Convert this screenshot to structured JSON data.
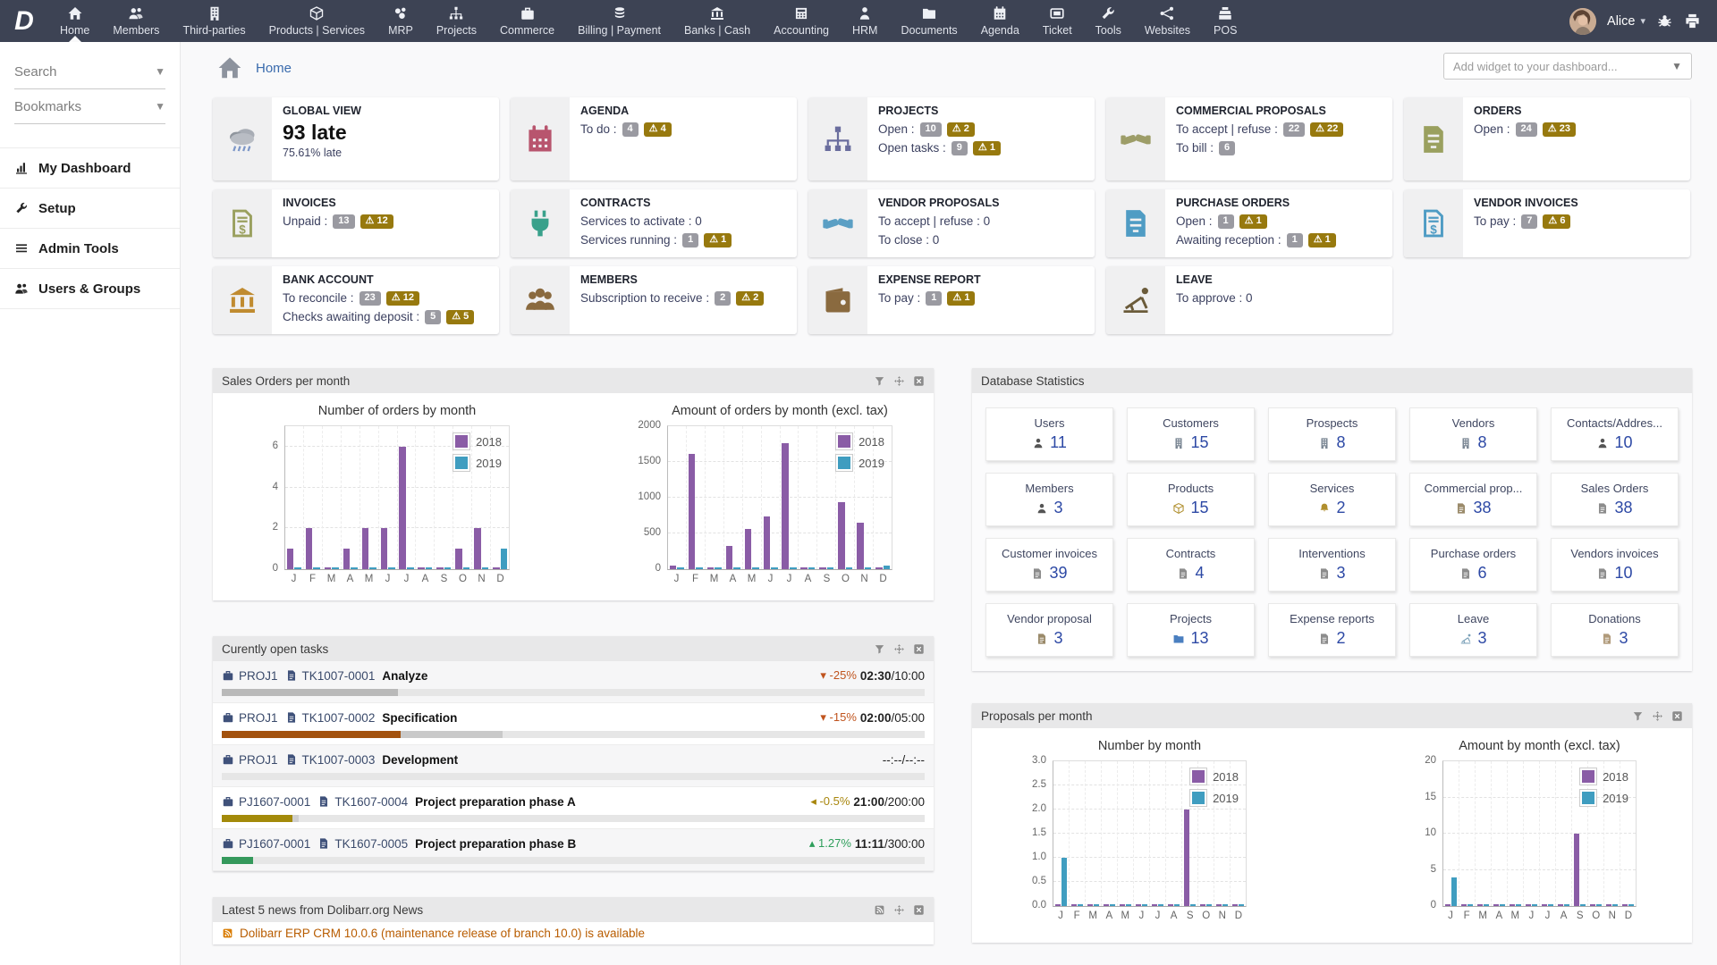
{
  "nav": {
    "logo": "D",
    "items": [
      {
        "label": "Home",
        "icon": "home"
      },
      {
        "label": "Members",
        "icon": "users"
      },
      {
        "label": "Third-parties",
        "icon": "building"
      },
      {
        "label": "Products | Services",
        "icon": "cube"
      },
      {
        "label": "MRP",
        "icon": "mrp"
      },
      {
        "label": "Projects",
        "icon": "sitemap"
      },
      {
        "label": "Commerce",
        "icon": "briefcase"
      },
      {
        "label": "Billing | Payment",
        "icon": "coins"
      },
      {
        "label": "Banks | Cash",
        "icon": "bank"
      },
      {
        "label": "Accounting",
        "icon": "calc"
      },
      {
        "label": "HRM",
        "icon": "person-tie"
      },
      {
        "label": "Documents",
        "icon": "folder"
      },
      {
        "label": "Agenda",
        "icon": "calendar"
      },
      {
        "label": "Ticket",
        "icon": "ticket"
      },
      {
        "label": "Tools",
        "icon": "wrench"
      },
      {
        "label": "Websites",
        "icon": "network"
      },
      {
        "label": "POS",
        "icon": "register"
      }
    ],
    "active_index": 0,
    "user_name": "Alice"
  },
  "sidebar": {
    "search_label": "Search",
    "bookmarks_label": "Bookmarks",
    "items": [
      {
        "label": "My Dashboard",
        "icon": "chart"
      },
      {
        "label": "Setup",
        "icon": "wrench"
      },
      {
        "label": "Admin Tools",
        "icon": "list"
      },
      {
        "label": "Users & Groups",
        "icon": "users"
      }
    ]
  },
  "header": {
    "breadcrumb": "Home",
    "add_widget_placeholder": "Add widget to your dashboard..."
  },
  "widgets": [
    {
      "title": "GLOBAL VIEW",
      "icon": "cloud-rain",
      "icon_color": "#9aa0a8",
      "tall": true,
      "big": "93 late",
      "sub": "75.61% late",
      "lines": []
    },
    {
      "title": "AGENDA",
      "icon": "calendar",
      "icon_color": "#b8556e",
      "tall": true,
      "lines": [
        {
          "text": "To do :",
          "count": "4",
          "warn": "4"
        }
      ]
    },
    {
      "title": "PROJECTS",
      "icon": "sitemap",
      "icon_color": "#6a6d9e",
      "tall": true,
      "lines": [
        {
          "text": "Open :",
          "count": "10",
          "warn": "2"
        },
        {
          "text": "Open tasks :",
          "count": "9",
          "warn": "1"
        }
      ]
    },
    {
      "title": "COMMERCIAL PROPOSALS",
      "icon": "handshake",
      "icon_color": "#9d9d68",
      "tall": true,
      "lines": [
        {
          "text": "To accept | refuse :",
          "count": "22",
          "warn": "22"
        },
        {
          "text": "To bill :",
          "count": "6"
        }
      ]
    },
    {
      "title": "ORDERS",
      "icon": "document",
      "icon_color": "#9aa05f",
      "tall": true,
      "lines": [
        {
          "text": "Open :",
          "count": "24",
          "warn": "23"
        }
      ]
    },
    {
      "title": "INVOICES",
      "icon": "bill",
      "icon_color": "#9aa05f",
      "lines": [
        {
          "text": "Unpaid :",
          "count": "13",
          "warn": "12"
        }
      ]
    },
    {
      "title": "CONTRACTS",
      "icon": "plug",
      "icon_color": "#39a18b",
      "lines": [
        {
          "text": "Services to activate : 0"
        },
        {
          "text": "Services running :",
          "count": "1",
          "warn": "1"
        }
      ]
    },
    {
      "title": "VENDOR PROPOSALS",
      "icon": "handshake",
      "icon_color": "#5b9fc4",
      "lines": [
        {
          "text": "To accept | refuse : 0"
        },
        {
          "text": "To close : 0"
        }
      ]
    },
    {
      "title": "PURCHASE ORDERS",
      "icon": "document",
      "icon_color": "#4f9cc4",
      "lines": [
        {
          "text": "Open :",
          "count": "1",
          "warn": "1"
        },
        {
          "text": "Awaiting reception :",
          "count": "1",
          "warn": "1"
        }
      ]
    },
    {
      "title": "VENDOR INVOICES",
      "icon": "bill",
      "icon_color": "#4f9cc4",
      "lines": [
        {
          "text": "To pay :",
          "count": "7",
          "warn": "6"
        }
      ]
    },
    {
      "title": "BANK ACCOUNT",
      "icon": "bank",
      "icon_color": "#c08b30",
      "lines": [
        {
          "text": "To reconcile :",
          "count": "23",
          "warn": "12"
        },
        {
          "text": "Checks awaiting deposit :",
          "count": "5",
          "warn": "5"
        }
      ]
    },
    {
      "title": "MEMBERS",
      "icon": "users-group",
      "icon_color": "#8a6a3f",
      "lines": [
        {
          "text": "Subscription to receive :",
          "count": "2",
          "warn": "2"
        }
      ]
    },
    {
      "title": "EXPENSE REPORT",
      "icon": "wallet",
      "icon_color": "#8a6a3f",
      "lines": [
        {
          "text": "To pay :",
          "count": "1",
          "warn": "1"
        }
      ]
    },
    {
      "title": "LEAVE",
      "icon": "beach",
      "icon_color": "#6b5b3a",
      "lines": [
        {
          "text": "To approve : 0"
        }
      ]
    }
  ],
  "panels": {
    "sales_orders": {
      "title": "Sales Orders per month",
      "icons": [
        "filter",
        "move",
        "close"
      ]
    },
    "db_stats": {
      "title": "Database Statistics",
      "cards": [
        {
          "label": "Users",
          "value": "11",
          "icon": "person",
          "icon_color": "#555555"
        },
        {
          "label": "Customers",
          "value": "15",
          "icon": "building",
          "icon_color": "#7b8794"
        },
        {
          "label": "Prospects",
          "value": "8",
          "icon": "building",
          "icon_color": "#7b8794"
        },
        {
          "label": "Vendors",
          "value": "8",
          "icon": "building",
          "icon_color": "#7b8794"
        },
        {
          "label": "Contacts/Addres...",
          "value": "10",
          "icon": "person",
          "icon_color": "#555555"
        },
        {
          "label": "Members",
          "value": "3",
          "icon": "person",
          "icon_color": "#555555"
        },
        {
          "label": "Products",
          "value": "15",
          "icon": "cube",
          "icon_color": "#b08f2e"
        },
        {
          "label": "Services",
          "value": "2",
          "icon": "bell",
          "icon_color": "#b08f2e"
        },
        {
          "label": "Commercial prop...",
          "value": "38",
          "icon": "page",
          "icon_color": "#9a8a6a"
        },
        {
          "label": "Sales Orders",
          "value": "38",
          "icon": "page",
          "icon_color": "#8c8c8c"
        },
        {
          "label": "Customer invoices",
          "value": "39",
          "icon": "page",
          "icon_color": "#8c8c8c"
        },
        {
          "label": "Contracts",
          "value": "4",
          "icon": "page",
          "icon_color": "#8c8c8c"
        },
        {
          "label": "Interventions",
          "value": "3",
          "icon": "page",
          "icon_color": "#8c8c8c"
        },
        {
          "label": "Purchase orders",
          "value": "6",
          "icon": "page",
          "icon_color": "#8c8c8c"
        },
        {
          "label": "Vendors invoices",
          "value": "10",
          "icon": "page",
          "icon_color": "#8c8c8c"
        },
        {
          "label": "Vendor proposal",
          "value": "3",
          "icon": "page",
          "icon_color": "#9a8a6a"
        },
        {
          "label": "Projects",
          "value": "13",
          "icon": "folder",
          "icon_color": "#4a7fc0"
        },
        {
          "label": "Expense reports",
          "value": "2",
          "icon": "page",
          "icon_color": "#8c8c8c"
        },
        {
          "label": "Leave",
          "value": "3",
          "icon": "beach",
          "icon_color": "#7aa0b8"
        },
        {
          "label": "Donations",
          "value": "3",
          "icon": "page",
          "icon_color": "#b09a7a"
        }
      ],
      "icons": []
    },
    "tasks": {
      "title": "Curently open tasks",
      "icons": [
        "filter",
        "move",
        "close"
      ],
      "rows": [
        {
          "project": "PROJ1",
          "task": "TK1007-0001",
          "name": "Analyze",
          "delta": "-25%",
          "delta_dir": "down",
          "delta_color": "#c0541e",
          "time_main": "02:30",
          "time_rest": "/10:00",
          "bars": [
            {
              "color": "#b9b9b9",
              "pct": 25
            }
          ]
        },
        {
          "project": "PROJ1",
          "task": "TK1007-0002",
          "name": "Specification",
          "delta": "-15%",
          "delta_dir": "down",
          "delta_color": "#c0541e",
          "time_main": "02:00",
          "time_rest": "/05:00",
          "bars": [
            {
              "color": "#a3520e",
              "pct": 25.5
            },
            {
              "color": "#c9c9c9",
              "pct": 14.5
            }
          ]
        },
        {
          "project": "PROJ1",
          "task": "TK1007-0003",
          "name": "Development",
          "delta": "",
          "delta_dir": "",
          "delta_color": "",
          "time_main": "",
          "time_rest": "--:--/--:--",
          "bars": []
        },
        {
          "project": "PJ1607-0001",
          "task": "TK1607-0004",
          "name": "Project preparation phase A",
          "delta": "-0.5%",
          "delta_dir": "left",
          "delta_color": "#a8860d",
          "time_main": "21:00",
          "time_rest": "/200:00",
          "bars": [
            {
              "color": "#a38a0a",
              "pct": 10
            },
            {
              "color": "#cfcfcf",
              "pct": 1
            }
          ]
        },
        {
          "project": "PJ1607-0001",
          "task": "TK1607-0005",
          "name": "Project preparation phase B",
          "delta": "1.27%",
          "delta_dir": "up",
          "delta_color": "#2e9e5b",
          "time_main": "11:11",
          "time_rest": "/300:00",
          "bars": [
            {
              "color": "#35995c",
              "pct": 4.5
            }
          ]
        }
      ]
    },
    "proposals": {
      "title": "Proposals per month",
      "icons": [
        "filter",
        "move",
        "close"
      ]
    },
    "news": {
      "title": "Latest 5 news from Dolibarr.org News",
      "icons": [
        "feed",
        "move",
        "close"
      ],
      "first_item": "Dolibarr ERP CRM 10.0.6 (maintenance release of branch 10.0) is available"
    }
  },
  "chart_data": [
    {
      "id": "orders_count",
      "type": "bar",
      "title": "Number of orders by month",
      "categories": [
        "J",
        "F",
        "M",
        "A",
        "M",
        "J",
        "J",
        "A",
        "S",
        "O",
        "N",
        "D"
      ],
      "series": [
        {
          "name": "2018",
          "color": "#8a5ca6",
          "values": [
            1,
            2,
            0,
            1,
            2,
            2,
            6,
            0,
            0,
            1,
            2,
            0
          ]
        },
        {
          "name": "2019",
          "color": "#3f9dc0",
          "values": [
            0,
            0,
            0,
            0,
            0,
            0,
            0,
            0,
            0,
            0,
            0,
            1
          ]
        }
      ],
      "yticks": [
        0,
        2,
        4,
        6
      ],
      "ytick_labels": [
        "0",
        "2",
        "4",
        "6"
      ],
      "ylim": [
        0,
        7
      ],
      "grid": true,
      "legend_position": "top-right"
    },
    {
      "id": "orders_amount",
      "type": "bar",
      "title": "Amount of orders by month (excl. tax)",
      "categories": [
        "J",
        "F",
        "M",
        "A",
        "M",
        "J",
        "J",
        "A",
        "S",
        "O",
        "N",
        "D"
      ],
      "series": [
        {
          "name": "2018",
          "color": "#8a5ca6",
          "values": [
            50,
            1610,
            0,
            330,
            560,
            740,
            1760,
            0,
            0,
            940,
            650,
            0
          ]
        },
        {
          "name": "2019",
          "color": "#3f9dc0",
          "values": [
            0,
            0,
            0,
            0,
            0,
            0,
            0,
            0,
            0,
            0,
            0,
            50
          ]
        }
      ],
      "yticks": [
        0,
        500,
        1000,
        1500,
        2000
      ],
      "ytick_labels": [
        "0",
        "500",
        "1000",
        "1500",
        "2000"
      ],
      "ylim": [
        0,
        2000
      ],
      "grid": true,
      "legend_position": "top-right"
    },
    {
      "id": "proposals_count",
      "type": "bar",
      "title": "Number by month",
      "categories": [
        "J",
        "F",
        "M",
        "A",
        "M",
        "J",
        "J",
        "A",
        "S",
        "O",
        "N",
        "D"
      ],
      "series": [
        {
          "name": "2018",
          "color": "#8a5ca6",
          "values": [
            0,
            0,
            0,
            0,
            0,
            0,
            0,
            0,
            2,
            0,
            0,
            0
          ]
        },
        {
          "name": "2019",
          "color": "#3f9dc0",
          "values": [
            1,
            0,
            0,
            0,
            0,
            0,
            0,
            0,
            0,
            0,
            0,
            0
          ]
        }
      ],
      "yticks": [
        0,
        0.5,
        1,
        1.5,
        2,
        2.5,
        3
      ],
      "ytick_labels": [
        "0.0",
        "0.5",
        "1.0",
        "1.5",
        "2.0",
        "2.5",
        "3.0"
      ],
      "ylim": [
        0,
        3
      ],
      "grid": true,
      "legend_position": "top-right"
    },
    {
      "id": "proposals_amount",
      "type": "bar",
      "title": "Amount by month (excl. tax)",
      "categories": [
        "J",
        "F",
        "M",
        "A",
        "M",
        "J",
        "J",
        "A",
        "S",
        "O",
        "N",
        "D"
      ],
      "series": [
        {
          "name": "2018",
          "color": "#8a5ca6",
          "values": [
            0,
            0,
            0,
            0,
            0,
            0,
            0,
            0,
            10,
            0,
            0,
            0
          ]
        },
        {
          "name": "2019",
          "color": "#3f9dc0",
          "values": [
            4,
            0,
            0,
            0,
            0,
            0,
            0,
            0,
            0,
            0,
            0,
            0
          ]
        }
      ],
      "yticks": [
        0,
        5,
        10,
        15,
        20
      ],
      "ytick_labels": [
        "0",
        "5",
        "10",
        "15",
        "20"
      ],
      "ylim": [
        0,
        20
      ],
      "grid": true,
      "legend_position": "top-right"
    }
  ],
  "colors": {
    "nav_bg": "#3d4354",
    "accent_purple": "#8a5ca6",
    "accent_blue": "#3f9dc0",
    "badge_gray": "#9a9aa1",
    "badge_warn": "#97790e",
    "stat_number": "#2d49a5"
  }
}
